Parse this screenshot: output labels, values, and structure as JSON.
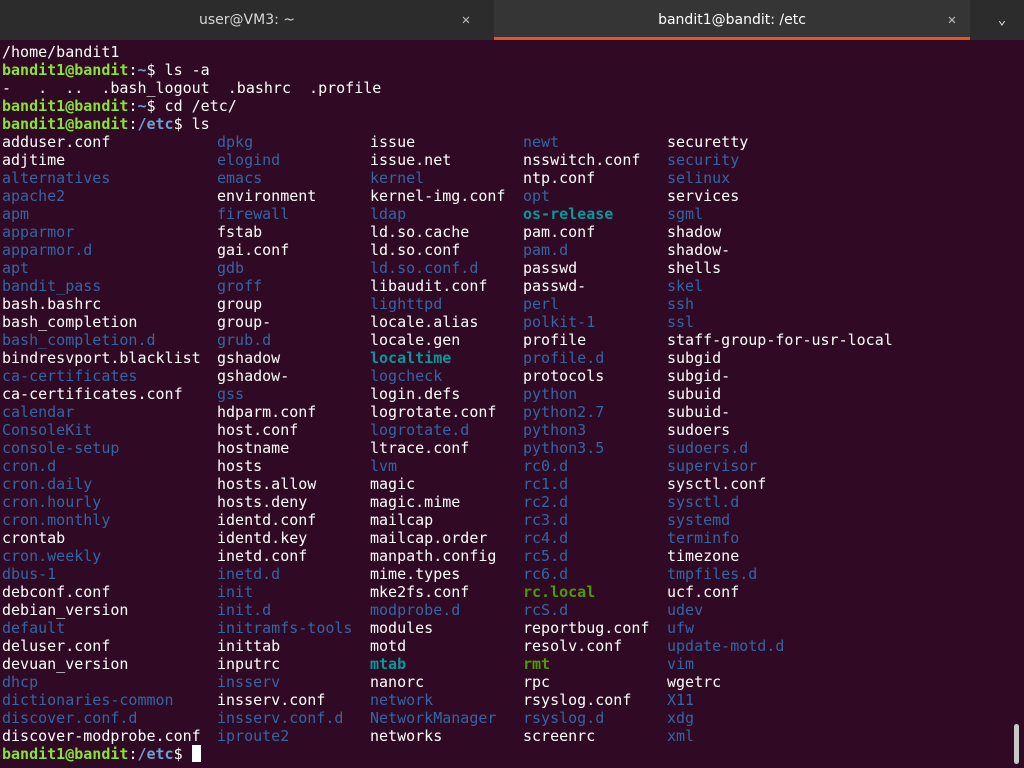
{
  "titlebar": {
    "tabs": [
      {
        "label": "user@VM3: ~",
        "active": false
      },
      {
        "label": "bandit1@bandit: /etc",
        "active": true
      }
    ],
    "close_glyph": "✕",
    "menu_glyph": "⌄"
  },
  "session": {
    "pwd_output": "/home/bandit1",
    "prompt_user_host": "bandit1@bandit",
    "prompt_colon": ":",
    "cmd1_path": "~",
    "cmd1": "$ ls -a",
    "ls_a_output": "-   .  ..  .bash_logout  .bashrc  .profile",
    "cmd2_path": "~",
    "cmd2": "$ cd /etc/",
    "cmd3_path": "/etc",
    "cmd3": "$ ls",
    "final_path": "/etc",
    "final_dollar": "$ "
  },
  "listing_columns": [
    [
      {
        "name": "adduser.conf",
        "type": "file"
      },
      {
        "name": "adjtime",
        "type": "file"
      },
      {
        "name": "alternatives",
        "type": "dir"
      },
      {
        "name": "apache2",
        "type": "dir"
      },
      {
        "name": "apm",
        "type": "dir"
      },
      {
        "name": "apparmor",
        "type": "dir"
      },
      {
        "name": "apparmor.d",
        "type": "dir"
      },
      {
        "name": "apt",
        "type": "dir"
      },
      {
        "name": "bandit_pass",
        "type": "dir"
      },
      {
        "name": "bash.bashrc",
        "type": "file"
      },
      {
        "name": "bash_completion",
        "type": "file"
      },
      {
        "name": "bash_completion.d",
        "type": "dir"
      },
      {
        "name": "bindresvport.blacklist",
        "type": "file"
      },
      {
        "name": "ca-certificates",
        "type": "dir"
      },
      {
        "name": "ca-certificates.conf",
        "type": "file"
      },
      {
        "name": "calendar",
        "type": "dir"
      },
      {
        "name": "ConsoleKit",
        "type": "dir"
      },
      {
        "name": "console-setup",
        "type": "dir"
      },
      {
        "name": "cron.d",
        "type": "dir"
      },
      {
        "name": "cron.daily",
        "type": "dir"
      },
      {
        "name": "cron.hourly",
        "type": "dir"
      },
      {
        "name": "cron.monthly",
        "type": "dir"
      },
      {
        "name": "crontab",
        "type": "file"
      },
      {
        "name": "cron.weekly",
        "type": "dir"
      },
      {
        "name": "dbus-1",
        "type": "dir"
      },
      {
        "name": "debconf.conf",
        "type": "file"
      },
      {
        "name": "debian_version",
        "type": "file"
      },
      {
        "name": "default",
        "type": "dir"
      },
      {
        "name": "deluser.conf",
        "type": "file"
      },
      {
        "name": "devuan_version",
        "type": "file"
      },
      {
        "name": "dhcp",
        "type": "dir"
      },
      {
        "name": "dictionaries-common",
        "type": "dir"
      },
      {
        "name": "discover.conf.d",
        "type": "dir"
      },
      {
        "name": "discover-modprobe.conf",
        "type": "file"
      }
    ],
    [
      {
        "name": "dpkg",
        "type": "dir"
      },
      {
        "name": "elogind",
        "type": "dir"
      },
      {
        "name": "emacs",
        "type": "dir"
      },
      {
        "name": "environment",
        "type": "file"
      },
      {
        "name": "firewall",
        "type": "dir"
      },
      {
        "name": "fstab",
        "type": "file"
      },
      {
        "name": "gai.conf",
        "type": "file"
      },
      {
        "name": "gdb",
        "type": "dir"
      },
      {
        "name": "groff",
        "type": "dir"
      },
      {
        "name": "group",
        "type": "file"
      },
      {
        "name": "group-",
        "type": "file"
      },
      {
        "name": "grub.d",
        "type": "dir"
      },
      {
        "name": "gshadow",
        "type": "file"
      },
      {
        "name": "gshadow-",
        "type": "file"
      },
      {
        "name": "gss",
        "type": "dir"
      },
      {
        "name": "hdparm.conf",
        "type": "file"
      },
      {
        "name": "host.conf",
        "type": "file"
      },
      {
        "name": "hostname",
        "type": "file"
      },
      {
        "name": "hosts",
        "type": "file"
      },
      {
        "name": "hosts.allow",
        "type": "file"
      },
      {
        "name": "hosts.deny",
        "type": "file"
      },
      {
        "name": "identd.conf",
        "type": "file"
      },
      {
        "name": "identd.key",
        "type": "file"
      },
      {
        "name": "inetd.conf",
        "type": "file"
      },
      {
        "name": "inetd.d",
        "type": "dir"
      },
      {
        "name": "init",
        "type": "dir"
      },
      {
        "name": "init.d",
        "type": "dir"
      },
      {
        "name": "initramfs-tools",
        "type": "dir"
      },
      {
        "name": "inittab",
        "type": "file"
      },
      {
        "name": "inputrc",
        "type": "file"
      },
      {
        "name": "insserv",
        "type": "dir"
      },
      {
        "name": "insserv.conf",
        "type": "file"
      },
      {
        "name": "insserv.conf.d",
        "type": "dir"
      },
      {
        "name": "iproute2",
        "type": "dir"
      }
    ],
    [
      {
        "name": "issue",
        "type": "file"
      },
      {
        "name": "issue.net",
        "type": "file"
      },
      {
        "name": "kernel",
        "type": "dir"
      },
      {
        "name": "kernel-img.conf",
        "type": "file"
      },
      {
        "name": "ldap",
        "type": "dir"
      },
      {
        "name": "ld.so.cache",
        "type": "file"
      },
      {
        "name": "ld.so.conf",
        "type": "file"
      },
      {
        "name": "ld.so.conf.d",
        "type": "dir"
      },
      {
        "name": "libaudit.conf",
        "type": "file"
      },
      {
        "name": "lighttpd",
        "type": "dir"
      },
      {
        "name": "locale.alias",
        "type": "file"
      },
      {
        "name": "locale.gen",
        "type": "file"
      },
      {
        "name": "localtime",
        "type": "link"
      },
      {
        "name": "logcheck",
        "type": "dir"
      },
      {
        "name": "login.defs",
        "type": "file"
      },
      {
        "name": "logrotate.conf",
        "type": "file"
      },
      {
        "name": "logrotate.d",
        "type": "dir"
      },
      {
        "name": "ltrace.conf",
        "type": "file"
      },
      {
        "name": "lvm",
        "type": "dir"
      },
      {
        "name": "magic",
        "type": "file"
      },
      {
        "name": "magic.mime",
        "type": "file"
      },
      {
        "name": "mailcap",
        "type": "file"
      },
      {
        "name": "mailcap.order",
        "type": "file"
      },
      {
        "name": "manpath.config",
        "type": "file"
      },
      {
        "name": "mime.types",
        "type": "file"
      },
      {
        "name": "mke2fs.conf",
        "type": "file"
      },
      {
        "name": "modprobe.d",
        "type": "dir"
      },
      {
        "name": "modules",
        "type": "file"
      },
      {
        "name": "motd",
        "type": "file"
      },
      {
        "name": "mtab",
        "type": "link"
      },
      {
        "name": "nanorc",
        "type": "file"
      },
      {
        "name": "network",
        "type": "dir"
      },
      {
        "name": "NetworkManager",
        "type": "dir"
      },
      {
        "name": "networks",
        "type": "file"
      }
    ],
    [
      {
        "name": "newt",
        "type": "dir"
      },
      {
        "name": "nsswitch.conf",
        "type": "file"
      },
      {
        "name": "ntp.conf",
        "type": "file"
      },
      {
        "name": "opt",
        "type": "dir"
      },
      {
        "name": "os-release",
        "type": "link"
      },
      {
        "name": "pam.conf",
        "type": "file"
      },
      {
        "name": "pam.d",
        "type": "dir"
      },
      {
        "name": "passwd",
        "type": "file"
      },
      {
        "name": "passwd-",
        "type": "file"
      },
      {
        "name": "perl",
        "type": "dir"
      },
      {
        "name": "polkit-1",
        "type": "dir"
      },
      {
        "name": "profile",
        "type": "file"
      },
      {
        "name": "profile.d",
        "type": "dir"
      },
      {
        "name": "protocols",
        "type": "file"
      },
      {
        "name": "python",
        "type": "dir"
      },
      {
        "name": "python2.7",
        "type": "dir"
      },
      {
        "name": "python3",
        "type": "dir"
      },
      {
        "name": "python3.5",
        "type": "dir"
      },
      {
        "name": "rc0.d",
        "type": "dir"
      },
      {
        "name": "rc1.d",
        "type": "dir"
      },
      {
        "name": "rc2.d",
        "type": "dir"
      },
      {
        "name": "rc3.d",
        "type": "dir"
      },
      {
        "name": "rc4.d",
        "type": "dir"
      },
      {
        "name": "rc5.d",
        "type": "dir"
      },
      {
        "name": "rc6.d",
        "type": "dir"
      },
      {
        "name": "rc.local",
        "type": "exec"
      },
      {
        "name": "rcS.d",
        "type": "dir"
      },
      {
        "name": "reportbug.conf",
        "type": "file"
      },
      {
        "name": "resolv.conf",
        "type": "file"
      },
      {
        "name": "rmt",
        "type": "exec"
      },
      {
        "name": "rpc",
        "type": "file"
      },
      {
        "name": "rsyslog.conf",
        "type": "file"
      },
      {
        "name": "rsyslog.d",
        "type": "dir"
      },
      {
        "name": "screenrc",
        "type": "file"
      }
    ],
    [
      {
        "name": "securetty",
        "type": "file"
      },
      {
        "name": "security",
        "type": "dir"
      },
      {
        "name": "selinux",
        "type": "dir"
      },
      {
        "name": "services",
        "type": "file"
      },
      {
        "name": "sgml",
        "type": "dir"
      },
      {
        "name": "shadow",
        "type": "file"
      },
      {
        "name": "shadow-",
        "type": "file"
      },
      {
        "name": "shells",
        "type": "file"
      },
      {
        "name": "skel",
        "type": "dir"
      },
      {
        "name": "ssh",
        "type": "dir"
      },
      {
        "name": "ssl",
        "type": "dir"
      },
      {
        "name": "staff-group-for-usr-local",
        "type": "file"
      },
      {
        "name": "subgid",
        "type": "file"
      },
      {
        "name": "subgid-",
        "type": "file"
      },
      {
        "name": "subuid",
        "type": "file"
      },
      {
        "name": "subuid-",
        "type": "file"
      },
      {
        "name": "sudoers",
        "type": "file"
      },
      {
        "name": "sudoers.d",
        "type": "dir"
      },
      {
        "name": "supervisor",
        "type": "dir"
      },
      {
        "name": "sysctl.conf",
        "type": "file"
      },
      {
        "name": "sysctl.d",
        "type": "dir"
      },
      {
        "name": "systemd",
        "type": "dir"
      },
      {
        "name": "terminfo",
        "type": "dir"
      },
      {
        "name": "timezone",
        "type": "file"
      },
      {
        "name": "tmpfiles.d",
        "type": "dir"
      },
      {
        "name": "ucf.conf",
        "type": "file"
      },
      {
        "name": "udev",
        "type": "dir"
      },
      {
        "name": "ufw",
        "type": "dir"
      },
      {
        "name": "update-motd.d",
        "type": "dir"
      },
      {
        "name": "vim",
        "type": "dir"
      },
      {
        "name": "wgetrc",
        "type": "file"
      },
      {
        "name": "X11",
        "type": "dir"
      },
      {
        "name": "xdg",
        "type": "dir"
      },
      {
        "name": "xml",
        "type": "dir"
      }
    ]
  ],
  "colors": {
    "background": "#300a24",
    "prompt_user": "#8ae234",
    "prompt_path": "#729fcf",
    "file": "#ffffff",
    "directory": "#3465a4",
    "symlink": "#06989a",
    "executable": "#4e9a06",
    "active_tab_underline": "#e95420"
  }
}
